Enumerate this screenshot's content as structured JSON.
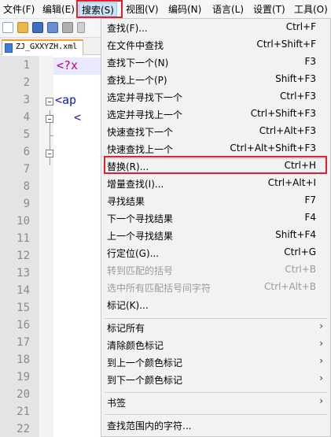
{
  "menubar": {
    "items": [
      "文件(F)",
      "编辑(E)",
      "搜索(S)",
      "视图(V)",
      "编码(N)",
      "语言(L)",
      "设置(T)",
      "工具(O)"
    ]
  },
  "tab": {
    "label": "ZJ_GXXYZH.xml"
  },
  "editor": {
    "line_numbers": [
      "1",
      "2",
      "3",
      "4",
      "5",
      "6",
      "7",
      "8",
      "9",
      "10",
      "11",
      "12",
      "13",
      "14",
      "15",
      "16",
      "17",
      "18",
      "19",
      "20",
      "21",
      "22"
    ],
    "line1": "<?x",
    "line3": "<ap",
    "line4": "<"
  },
  "dropdown": {
    "items": [
      {
        "label": "查找(F)...",
        "shortcut": "Ctrl+F"
      },
      {
        "label": "在文件中查找",
        "shortcut": "Ctrl+Shift+F"
      },
      {
        "label": "查找下一个(N)",
        "shortcut": "F3"
      },
      {
        "label": "查找上一个(P)",
        "shortcut": "Shift+F3"
      },
      {
        "label": "选定并寻找下一个",
        "shortcut": "Ctrl+F3"
      },
      {
        "label": "选定并寻找上一个",
        "shortcut": "Ctrl+Shift+F3"
      },
      {
        "label": "快速查找下一个",
        "shortcut": "Ctrl+Alt+F3"
      },
      {
        "label": "快速查找上一个",
        "shortcut": "Ctrl+Alt+Shift+F3"
      },
      {
        "label": "替换(R)...",
        "shortcut": "Ctrl+H"
      },
      {
        "label": "增量查找(I)...",
        "shortcut": "Ctrl+Alt+I"
      },
      {
        "label": "寻找结果",
        "shortcut": "F7"
      },
      {
        "label": "下一个寻找结果",
        "shortcut": "F4"
      },
      {
        "label": "上一个寻找结果",
        "shortcut": "Shift+F4"
      },
      {
        "label": "行定位(G)...",
        "shortcut": "Ctrl+G"
      },
      {
        "label": "转到匹配的括号",
        "shortcut": "Ctrl+B"
      },
      {
        "label": "选中所有匹配括号间字符",
        "shortcut": "Ctrl+Alt+B"
      },
      {
        "label": "标记(K)...",
        "shortcut": ""
      }
    ],
    "submenus": [
      {
        "label": "标记所有",
        "arrow": "›"
      },
      {
        "label": "清除颜色标记",
        "arrow": "›"
      },
      {
        "label": "到上一个颜色标记",
        "arrow": "›"
      },
      {
        "label": "到下一个颜色标记",
        "arrow": "›"
      }
    ],
    "bookmark": {
      "label": "书签",
      "arrow": "›"
    },
    "find_in_range": {
      "label": "查找范围内的字符..."
    }
  },
  "colors": {
    "highlight_border": "#e0202a",
    "code_red": "#c0007a",
    "code_blue": "#1a1aa6"
  }
}
